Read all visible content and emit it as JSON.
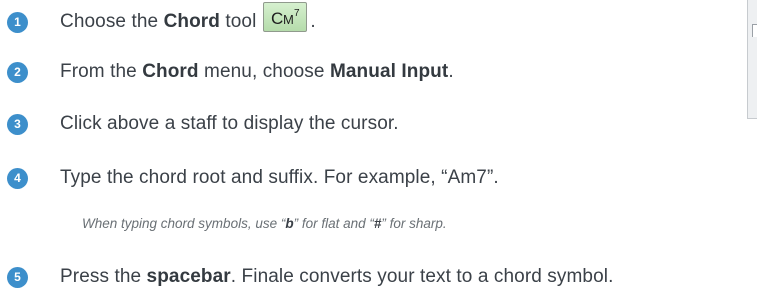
{
  "steps": [
    {
      "number": "1",
      "pre": "Choose the ",
      "bold": "Chord",
      "post": " tool",
      "tool_icon": {
        "name": "chord-tool-icon",
        "letter": "C",
        "sub": "M",
        "sup": "7"
      },
      "end": "."
    },
    {
      "number": "2",
      "pre": "From the ",
      "bold1": "Chord",
      "mid": " menu, choose ",
      "bold2": "Manual Input",
      "post": "."
    },
    {
      "number": "3",
      "text": "Click above a staff to display the cursor."
    },
    {
      "number": "4",
      "text": "Type the chord root and suffix. For example, “Am7”."
    },
    {
      "number": "5",
      "pre": "Press the ",
      "bold": "spacebar",
      "post": ". Finale converts your text to a chord symbol."
    }
  ],
  "note": {
    "pre": "When typing chord symbols, use “",
    "flat_char": "b",
    "mid": "” for flat and “",
    "sharp_char": "#",
    "post": "” for sharp."
  },
  "colors": {
    "step_badge": "#3d8fcb",
    "text": "#3b4148",
    "note_text": "#6a7075",
    "tool_button_fill": "#c6e8bd"
  }
}
